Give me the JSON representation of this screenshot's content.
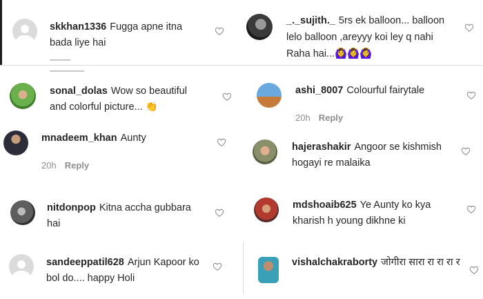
{
  "comments": [
    {
      "user": "skkhan1336",
      "text": "Fugga apne itna bada liye hai"
    },
    {
      "user": "_._sujith._",
      "text": "5rs ek balloon... balloon lelo balloon ,areyyy koi ley q nahi Raha hai...",
      "emoji": "🙆‍♀️🙆‍♀️🙆‍♀️"
    },
    {
      "user": "sonal_dolas",
      "text": "Wow so beautiful and colorful picture...",
      "emoji": "👏"
    },
    {
      "user": "ashi_8007",
      "text": "Colourful fairytale",
      "time": "20h",
      "reply": "Reply"
    },
    {
      "user": "mnadeem_khan",
      "text": "Aunty",
      "time": "20h",
      "reply": "Reply"
    },
    {
      "user": "hajerashakir",
      "text": "Angoor se kishmish hogayi re malaika"
    },
    {
      "user": "nitdonpop",
      "text": "Kitna accha gubbara hai"
    },
    {
      "user": "mdshoaib625",
      "text": "Ye Aunty ko kya kharish h young dikhne ki"
    },
    {
      "user": "sandeeppatil628",
      "text": "Arjun Kapoor ko bol do.... happy Holi"
    },
    {
      "user": "vishalchakraborty",
      "text": "जोगीरा सारा रा रा रा र"
    }
  ],
  "colors": {
    "text": "#262626",
    "muted": "#8e8e8e",
    "heart": "#8e8e8e"
  },
  "icons": {
    "like": "heart-outline-icon",
    "avatar_default": "default-avatar-icon"
  }
}
